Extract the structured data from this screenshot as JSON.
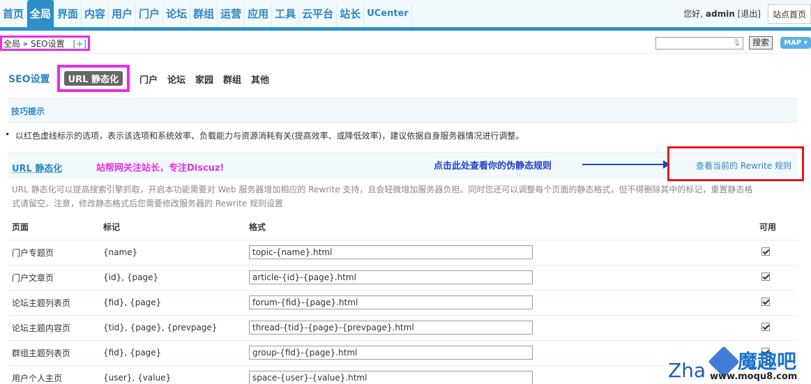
{
  "topnav": {
    "items": [
      "首页",
      "全局",
      "界面",
      "内容",
      "用户",
      "门户",
      "论坛",
      "群组",
      "运营",
      "应用",
      "工具",
      "云平台",
      "站长",
      "UCenter"
    ],
    "active_index": 1,
    "greeting_prefix": "您好,",
    "username": "admin",
    "logout": "[退出]",
    "site_home": "站点首页"
  },
  "breadcrumb": {
    "path": "全局 » SEO设置",
    "plus": "[+]"
  },
  "search": {
    "value": "",
    "button": "搜索",
    "map": "MAP ▾"
  },
  "subnav": {
    "title": "SEO设置",
    "active_tab": "URL 静态化",
    "tabs": [
      "门户",
      "论坛",
      "家园",
      "群组",
      "其他"
    ]
  },
  "tips": {
    "title": "技巧提示",
    "bullet": "•",
    "text": "以红色虚线标示的选项，表示该选项和系统效率、负载能力与资源消耗有关(提高效率、或降低效率)，建议依据自身服务器情况进行调整。"
  },
  "section": {
    "title": "URL 静态化",
    "annotation_pink": "站帮网关注站长，专注Discuz!",
    "annotation_blue": "点击此处查看你的伪静态规则",
    "rewrite_link": "查看当前的 Rewrite 规则",
    "description": "URL 静态化可以提高搜索引擎抓取，开启本功能需要对 Web 服务器增加相应的 Rewrite 支持，且会轻微增加服务器负担。同时您还可以调整每个页面的静态格式，但不得删除其中的标记，重置静态格式请留空。注意，修改静态格式后您需要修改服务器的 Rewrite 规则设置"
  },
  "table": {
    "headers": {
      "page": "页面",
      "mark": "标记",
      "format": "格式",
      "enabled": "可用"
    },
    "rows": [
      {
        "page": "门户专题页",
        "mark": "{name}",
        "format": "topic-{name}.html",
        "enabled": true
      },
      {
        "page": "门户文章页",
        "mark": "{id}, {page}",
        "format": "article-{id}-{page}.html",
        "enabled": true
      },
      {
        "page": "论坛主题列表页",
        "mark": "{fid}, {page}",
        "format": "forum-{fid}-{page}.html",
        "enabled": true
      },
      {
        "page": "论坛主题内容页",
        "mark": "{tid}, {page}, {prevpage}",
        "format": "thread-{tid}-{page}-{prevpage}.html",
        "enabled": true
      },
      {
        "page": "群组主题列表页",
        "mark": "{fid}, {page}",
        "format": "group-{fid}-{page}.html",
        "enabled": true
      },
      {
        "page": "用户个人主页",
        "mark": "{user}, {value}",
        "format": "space-{user}-{value}.html",
        "enabled": true
      }
    ]
  },
  "watermark": {
    "left": "Zha",
    "name": "魔趣吧",
    "url": "www.moqu8.com"
  }
}
